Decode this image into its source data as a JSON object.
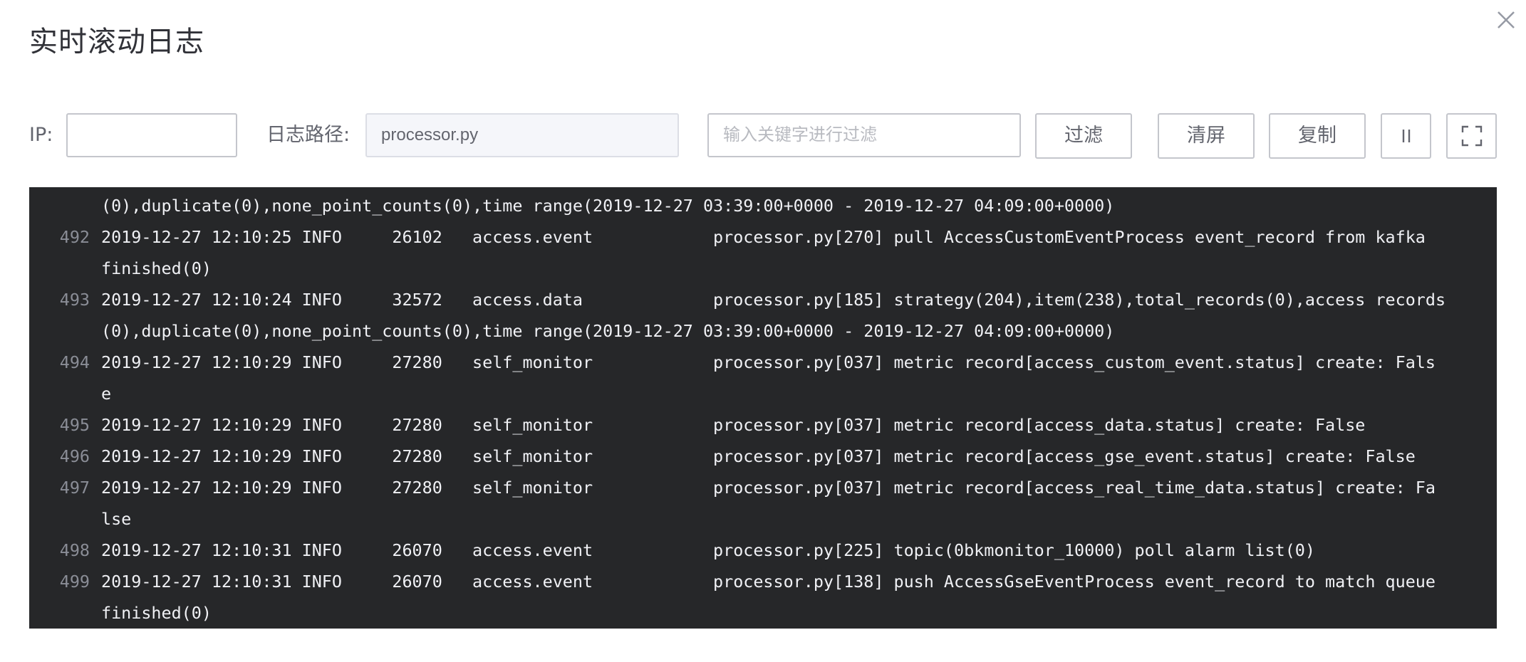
{
  "dialog": {
    "title": "实时滚动日志"
  },
  "toolbar": {
    "ip_label": "IP:",
    "ip_value": "",
    "path_label": "日志路径:",
    "path_value": "processor.py",
    "filter_placeholder": "输入关键字进行过滤",
    "filter_button": "过滤",
    "clear_button": "清屏",
    "copy_button": "复制",
    "pause_icon": "pause-icon",
    "fullscreen_icon": "fullscreen-icon"
  },
  "log": {
    "lines": [
      {
        "no": "",
        "text": "(0),duplicate(0),none_point_counts(0),time range(2019-12-27 03:39:00+0000 - 2019-12-27 04:09:00+0000)"
      },
      {
        "no": "492",
        "text": "2019-12-27 12:10:25 INFO     26102   access.event            processor.py[270] pull AccessCustomEventProcess event_record from kafka"
      },
      {
        "no": "",
        "text": "finished(0)"
      },
      {
        "no": "493",
        "text": "2019-12-27 12:10:24 INFO     32572   access.data             processor.py[185] strategy(204),item(238),total_records(0),access records"
      },
      {
        "no": "",
        "text": "(0),duplicate(0),none_point_counts(0),time range(2019-12-27 03:39:00+0000 - 2019-12-27 04:09:00+0000)"
      },
      {
        "no": "494",
        "text": "2019-12-27 12:10:29 INFO     27280   self_monitor            processor.py[037] metric record[access_custom_event.status] create: Fals"
      },
      {
        "no": "",
        "text": "e"
      },
      {
        "no": "495",
        "text": "2019-12-27 12:10:29 INFO     27280   self_monitor            processor.py[037] metric record[access_data.status] create: False"
      },
      {
        "no": "496",
        "text": "2019-12-27 12:10:29 INFO     27280   self_monitor            processor.py[037] metric record[access_gse_event.status] create: False"
      },
      {
        "no": "497",
        "text": "2019-12-27 12:10:29 INFO     27280   self_monitor            processor.py[037] metric record[access_real_time_data.status] create: Fa"
      },
      {
        "no": "",
        "text": "lse"
      },
      {
        "no": "498",
        "text": "2019-12-27 12:10:31 INFO     26070   access.event            processor.py[225] topic(0bkmonitor_10000) poll alarm list(0)"
      },
      {
        "no": "499",
        "text": "2019-12-27 12:10:31 INFO     26070   access.event            processor.py[138] push AccessGseEventProcess event_record to match queue"
      },
      {
        "no": "",
        "text": "finished(0)"
      }
    ]
  },
  "colors": {
    "log_background": "#262729",
    "log_text": "#f0f1f5",
    "line_number": "#8a8d96",
    "border": "#c4c6cc"
  }
}
